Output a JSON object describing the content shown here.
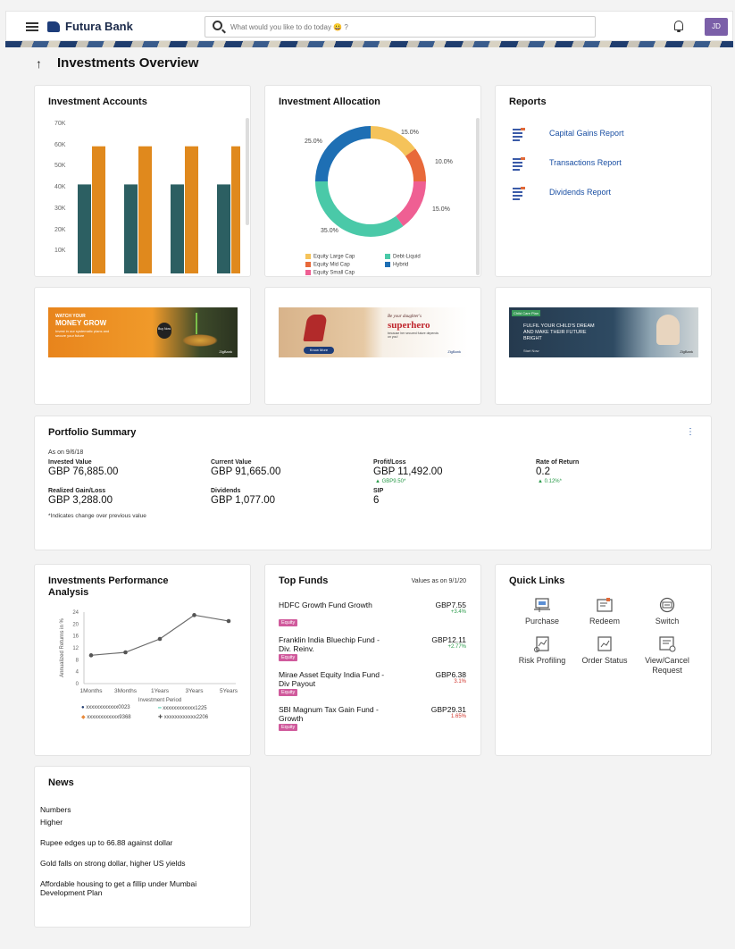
{
  "app": {
    "brand": "Futura Bank",
    "user_initials": "JD"
  },
  "search": {
    "placeholder": "What would you like to do today 😀 ?"
  },
  "page": {
    "title": "Investments Overview"
  },
  "investment_accounts": {
    "title": "Investment Accounts",
    "y_ticks": [
      "70K",
      "60K",
      "50K",
      "40K",
      "30K",
      "20K",
      "10K"
    ],
    "colors": {
      "series_a": "#2c5f62",
      "series_b": "#e0891d"
    },
    "chart_data": {
      "type": "bar",
      "categories": [
        "",
        "",
        "",
        ""
      ],
      "series": [
        {
          "values": [
            42000,
            42000,
            42000,
            42000
          ]
        },
        {
          "values": [
            60000,
            60000,
            60000,
            60000
          ]
        }
      ],
      "ylim": [
        0,
        70000
      ]
    }
  },
  "investment_allocation": {
    "title": "Investment Allocation",
    "chart_data": {
      "type": "pie",
      "slices": [
        {
          "label": "Equity Large Cap",
          "value": 15.0,
          "pct_label": "15.0%",
          "color": "#f5c35a"
        },
        {
          "label": "Equity Mid Cap",
          "value": 10.0,
          "pct_label": "10.0%",
          "color": "#e8693a"
        },
        {
          "label": "Equity Small Cap",
          "value": 15.0,
          "pct_label": "15.0%",
          "color": "#ef5f93"
        },
        {
          "label": "Debt-Liquid",
          "value": 35.0,
          "pct_label": "35.0%",
          "color": "#4ac9a8"
        },
        {
          "label": "Hybrid",
          "value": 25.0,
          "pct_label": "25.0%",
          "color": "#1e6fb4"
        }
      ]
    }
  },
  "reports": {
    "title": "Reports",
    "items": [
      {
        "label": "Capital Gains Report"
      },
      {
        "label": "Transactions Report"
      },
      {
        "label": "Dividends Report"
      }
    ]
  },
  "promos": {
    "p1": {
      "line1": "WATCH YOUR",
      "line2": "MONEY GROW",
      "line3": "Invest in our systematic plans and secure your future",
      "cta": "Buy Now",
      "brand": "ZigBank"
    },
    "p2": {
      "line1": "Be your daughter's",
      "line2": "superhero",
      "line3": "because her secured future depends on you!",
      "cta": "Know More",
      "brand": "ZigBank"
    },
    "p3": {
      "tag": "Child Care Plan",
      "line1": "FULFIL YOUR CHILD'S DREAM",
      "line2": "AND MAKE THEIR FUTURE",
      "line3": "BRIGHT",
      "cta": "Start Now",
      "brand": "ZigBank"
    }
  },
  "portfolio_summary": {
    "title": "Portfolio Summary",
    "as_on": "As on 9/6/18",
    "invested_label": "Invested Value",
    "invested_value": "GBP 76,885.00",
    "current_label": "Current Value",
    "current_value": "GBP 91,665.00",
    "pl_label": "Profit/Loss",
    "pl_value": "GBP 11,492.00",
    "pl_change": "▲ GBP9.50*",
    "ror_label": "Rate of Return",
    "ror_value": "0.2",
    "ror_change": "▲ 0.12%*",
    "realized_label": "Realized Gain/Loss",
    "realized_value": "GBP 3,288.00",
    "dividends_label": "Dividends",
    "dividends_value": "GBP 1,077.00",
    "sip_label": "SIP",
    "sip_value": "6",
    "footnote": "*Indicates change over previous value",
    "menu": "⋮"
  },
  "performance": {
    "title_line1": "Investments Performance",
    "title_line2": "Analysis",
    "ylabel": "Annualized Returns in %",
    "xlabel": "Investment Period",
    "y_ticks": [
      "24",
      "20",
      "16",
      "12",
      "8",
      "4",
      "0"
    ],
    "chart_data": {
      "type": "line",
      "categories": [
        "1Months",
        "3Months",
        "1Years",
        "3Years",
        "5Years"
      ],
      "series": [
        {
          "name": "xxxxxxxxxxxx0023",
          "values": [
            9.5,
            10.5,
            15.0,
            23.0,
            21.0
          ]
        }
      ],
      "ylim": [
        0,
        24
      ],
      "xlabel": "Investment Period",
      "ylabel": "Annualized Returns in %"
    },
    "legend": [
      {
        "name": "xxxxxxxxxxxx0023",
        "color": "#1e3a6e",
        "marker": "●"
      },
      {
        "name": "xxxxxxxxxxxx1225",
        "color": "#4ac9a8",
        "marker": "━"
      },
      {
        "name": "xxxxxxxxxxxx9368",
        "color": "#e8893a",
        "marker": "◆"
      },
      {
        "name": "xxxxxxxxxxxx2206",
        "color": "#555555",
        "marker": "✚"
      }
    ]
  },
  "top_funds": {
    "title": "Top Funds",
    "values_as_on": "Values as on 9/1/20",
    "badge": "Equity",
    "funds": [
      {
        "name": "HDFC Growth Fund Growth",
        "value": "GBP7.55",
        "change": "+3.4%",
        "up": true
      },
      {
        "name": "Franklin India Bluechip Fund - Div. Reinv.",
        "value": "GBP12.11",
        "change": "+2.77%",
        "up": true
      },
      {
        "name": "Mirae Asset Equity India Fund - Div Payout",
        "value": "GBP6.38",
        "change": "3.1%",
        "up": false
      },
      {
        "name": "SBI Magnum Tax Gain Fund - Growth",
        "value": "GBP29.31",
        "change": "1.65%",
        "up": false
      }
    ]
  },
  "quick_links": {
    "title": "Quick Links",
    "items": [
      {
        "label": "Purchase",
        "icon": "purchase-icon"
      },
      {
        "label": "Redeem",
        "icon": "redeem-icon"
      },
      {
        "label": "Switch",
        "icon": "switch-icon"
      },
      {
        "label": "Risk Profiling",
        "icon": "risk-profiling-icon"
      },
      {
        "label": "Order Status",
        "icon": "order-status-icon"
      },
      {
        "label": "View/Cancel Request",
        "icon": "view-cancel-icon"
      }
    ]
  },
  "news": {
    "title": "News",
    "items": [
      "Numbers",
      "Higher",
      "Rupee edges up to 66.88 against dollar",
      "Gold falls on strong dollar, higher US yields",
      "Affordable housing to get a fillip under Mumbai Development Plan"
    ]
  }
}
